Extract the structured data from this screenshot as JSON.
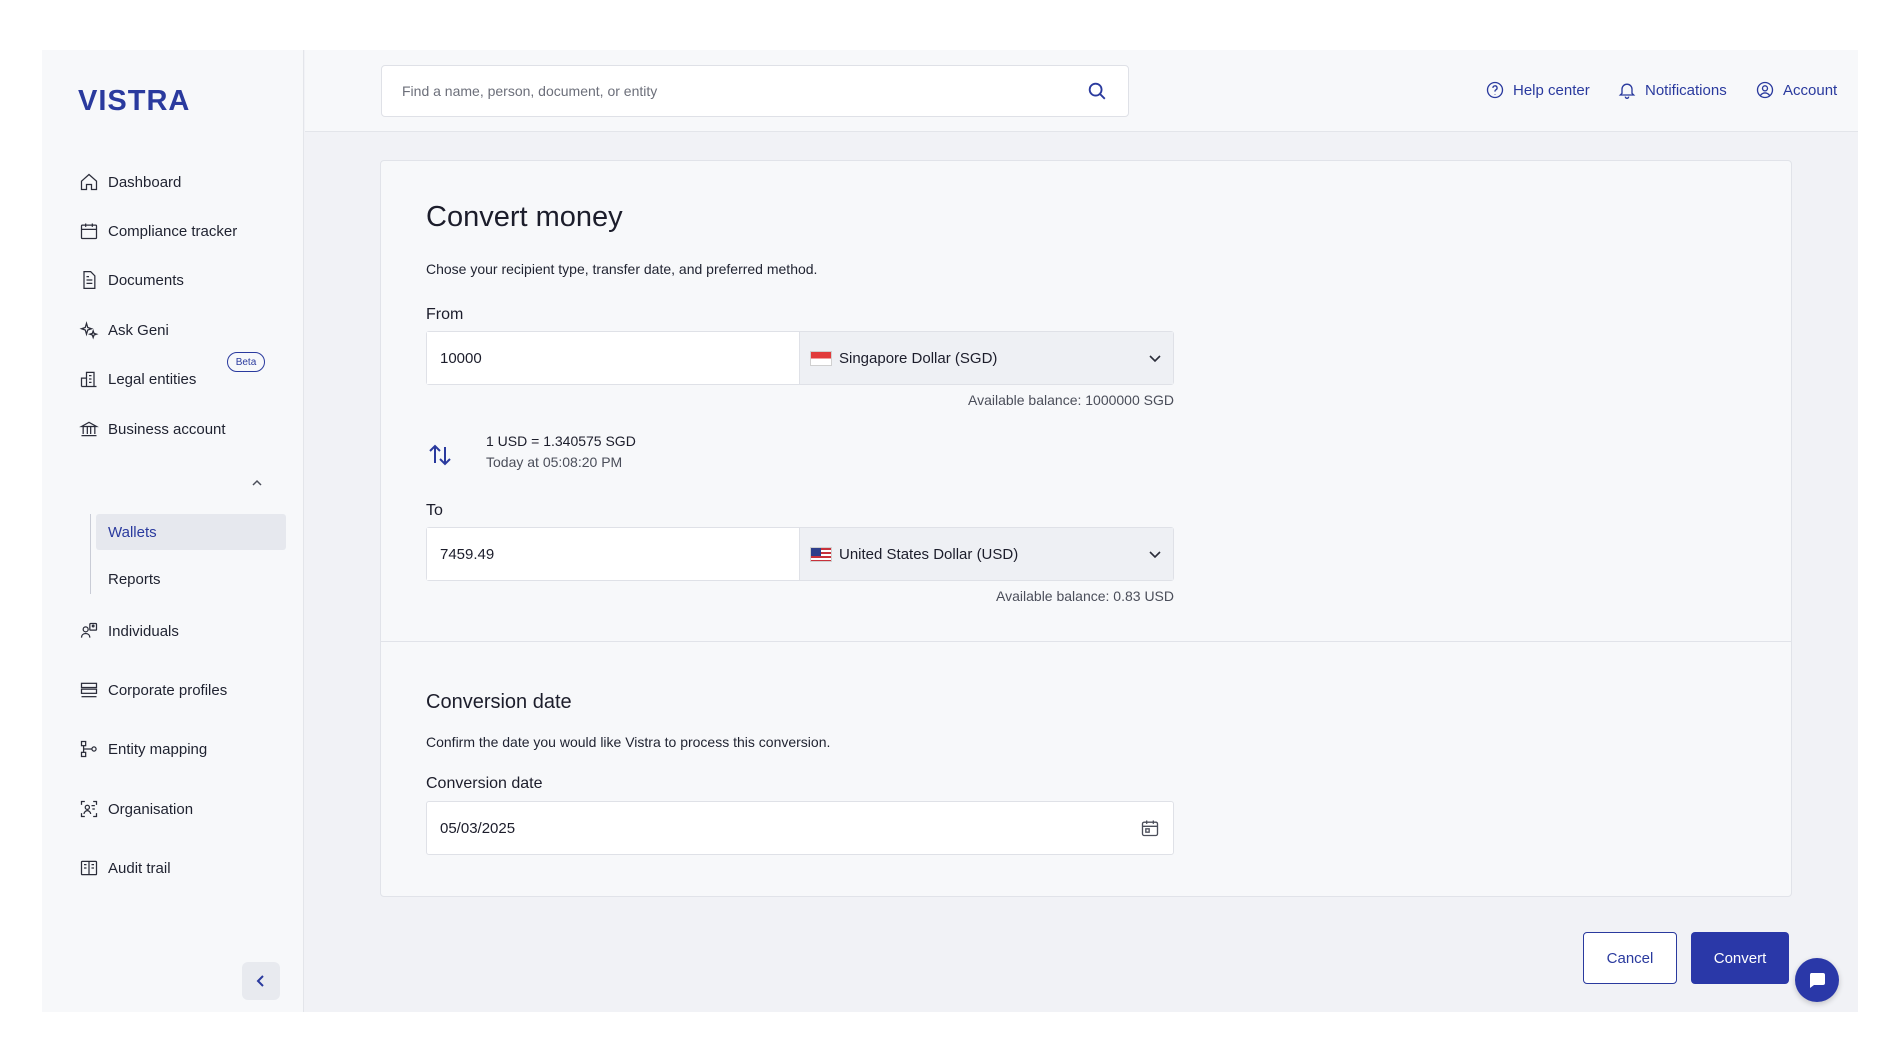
{
  "brand": {
    "logo_text": "VISTRA",
    "accent_color": "#2a3a9e",
    "button_color": "#2a38a8"
  },
  "sidebar": {
    "items": [
      {
        "label": "Dashboard",
        "icon": "home-icon"
      },
      {
        "label": "Compliance tracker",
        "icon": "calendar-icon"
      },
      {
        "label": "Documents",
        "icon": "document-icon"
      },
      {
        "label": "Ask Geni",
        "icon": "sparkle-icon",
        "badge": "Beta"
      },
      {
        "label": "Legal entities",
        "icon": "buildings-icon"
      },
      {
        "label": "Business account",
        "icon": "bank-icon",
        "expanded": true
      },
      {
        "label": "Individuals",
        "icon": "people-icon"
      },
      {
        "label": "Corporate profiles",
        "icon": "stack-icon"
      },
      {
        "label": "Entity mapping",
        "icon": "hierarchy-icon"
      },
      {
        "label": "Organisation",
        "icon": "org-icon"
      },
      {
        "label": "Audit trail",
        "icon": "book-icon"
      }
    ],
    "sub_items": [
      {
        "label": "Wallets",
        "active": true
      },
      {
        "label": "Reports",
        "active": false
      }
    ]
  },
  "topbar": {
    "search_placeholder": "Find a name, person, document, or entity",
    "help_label": "Help center",
    "notifications_label": "Notifications",
    "account_label": "Account"
  },
  "convert": {
    "title": "Convert money",
    "description": "Chose your recipient type, transfer date, and preferred method.",
    "from_label": "From",
    "from_amount": "10000",
    "from_currency": "Singapore Dollar (SGD)",
    "from_balance": "Available balance: 1000000 SGD",
    "rate": "1 USD = 1.340575 SGD",
    "rate_time": "Today at 05:08:20 PM",
    "to_label": "To",
    "to_amount": "7459.49",
    "to_currency": "United States Dollar (USD)",
    "to_balance": "Available balance: 0.83 USD"
  },
  "conversion_date": {
    "heading": "Conversion date",
    "description": "Confirm the date you would like Vistra to process this conversion.",
    "field_label": "Conversion date",
    "value": "05/03/2025"
  },
  "actions": {
    "cancel_label": "Cancel",
    "convert_label": "Convert"
  }
}
